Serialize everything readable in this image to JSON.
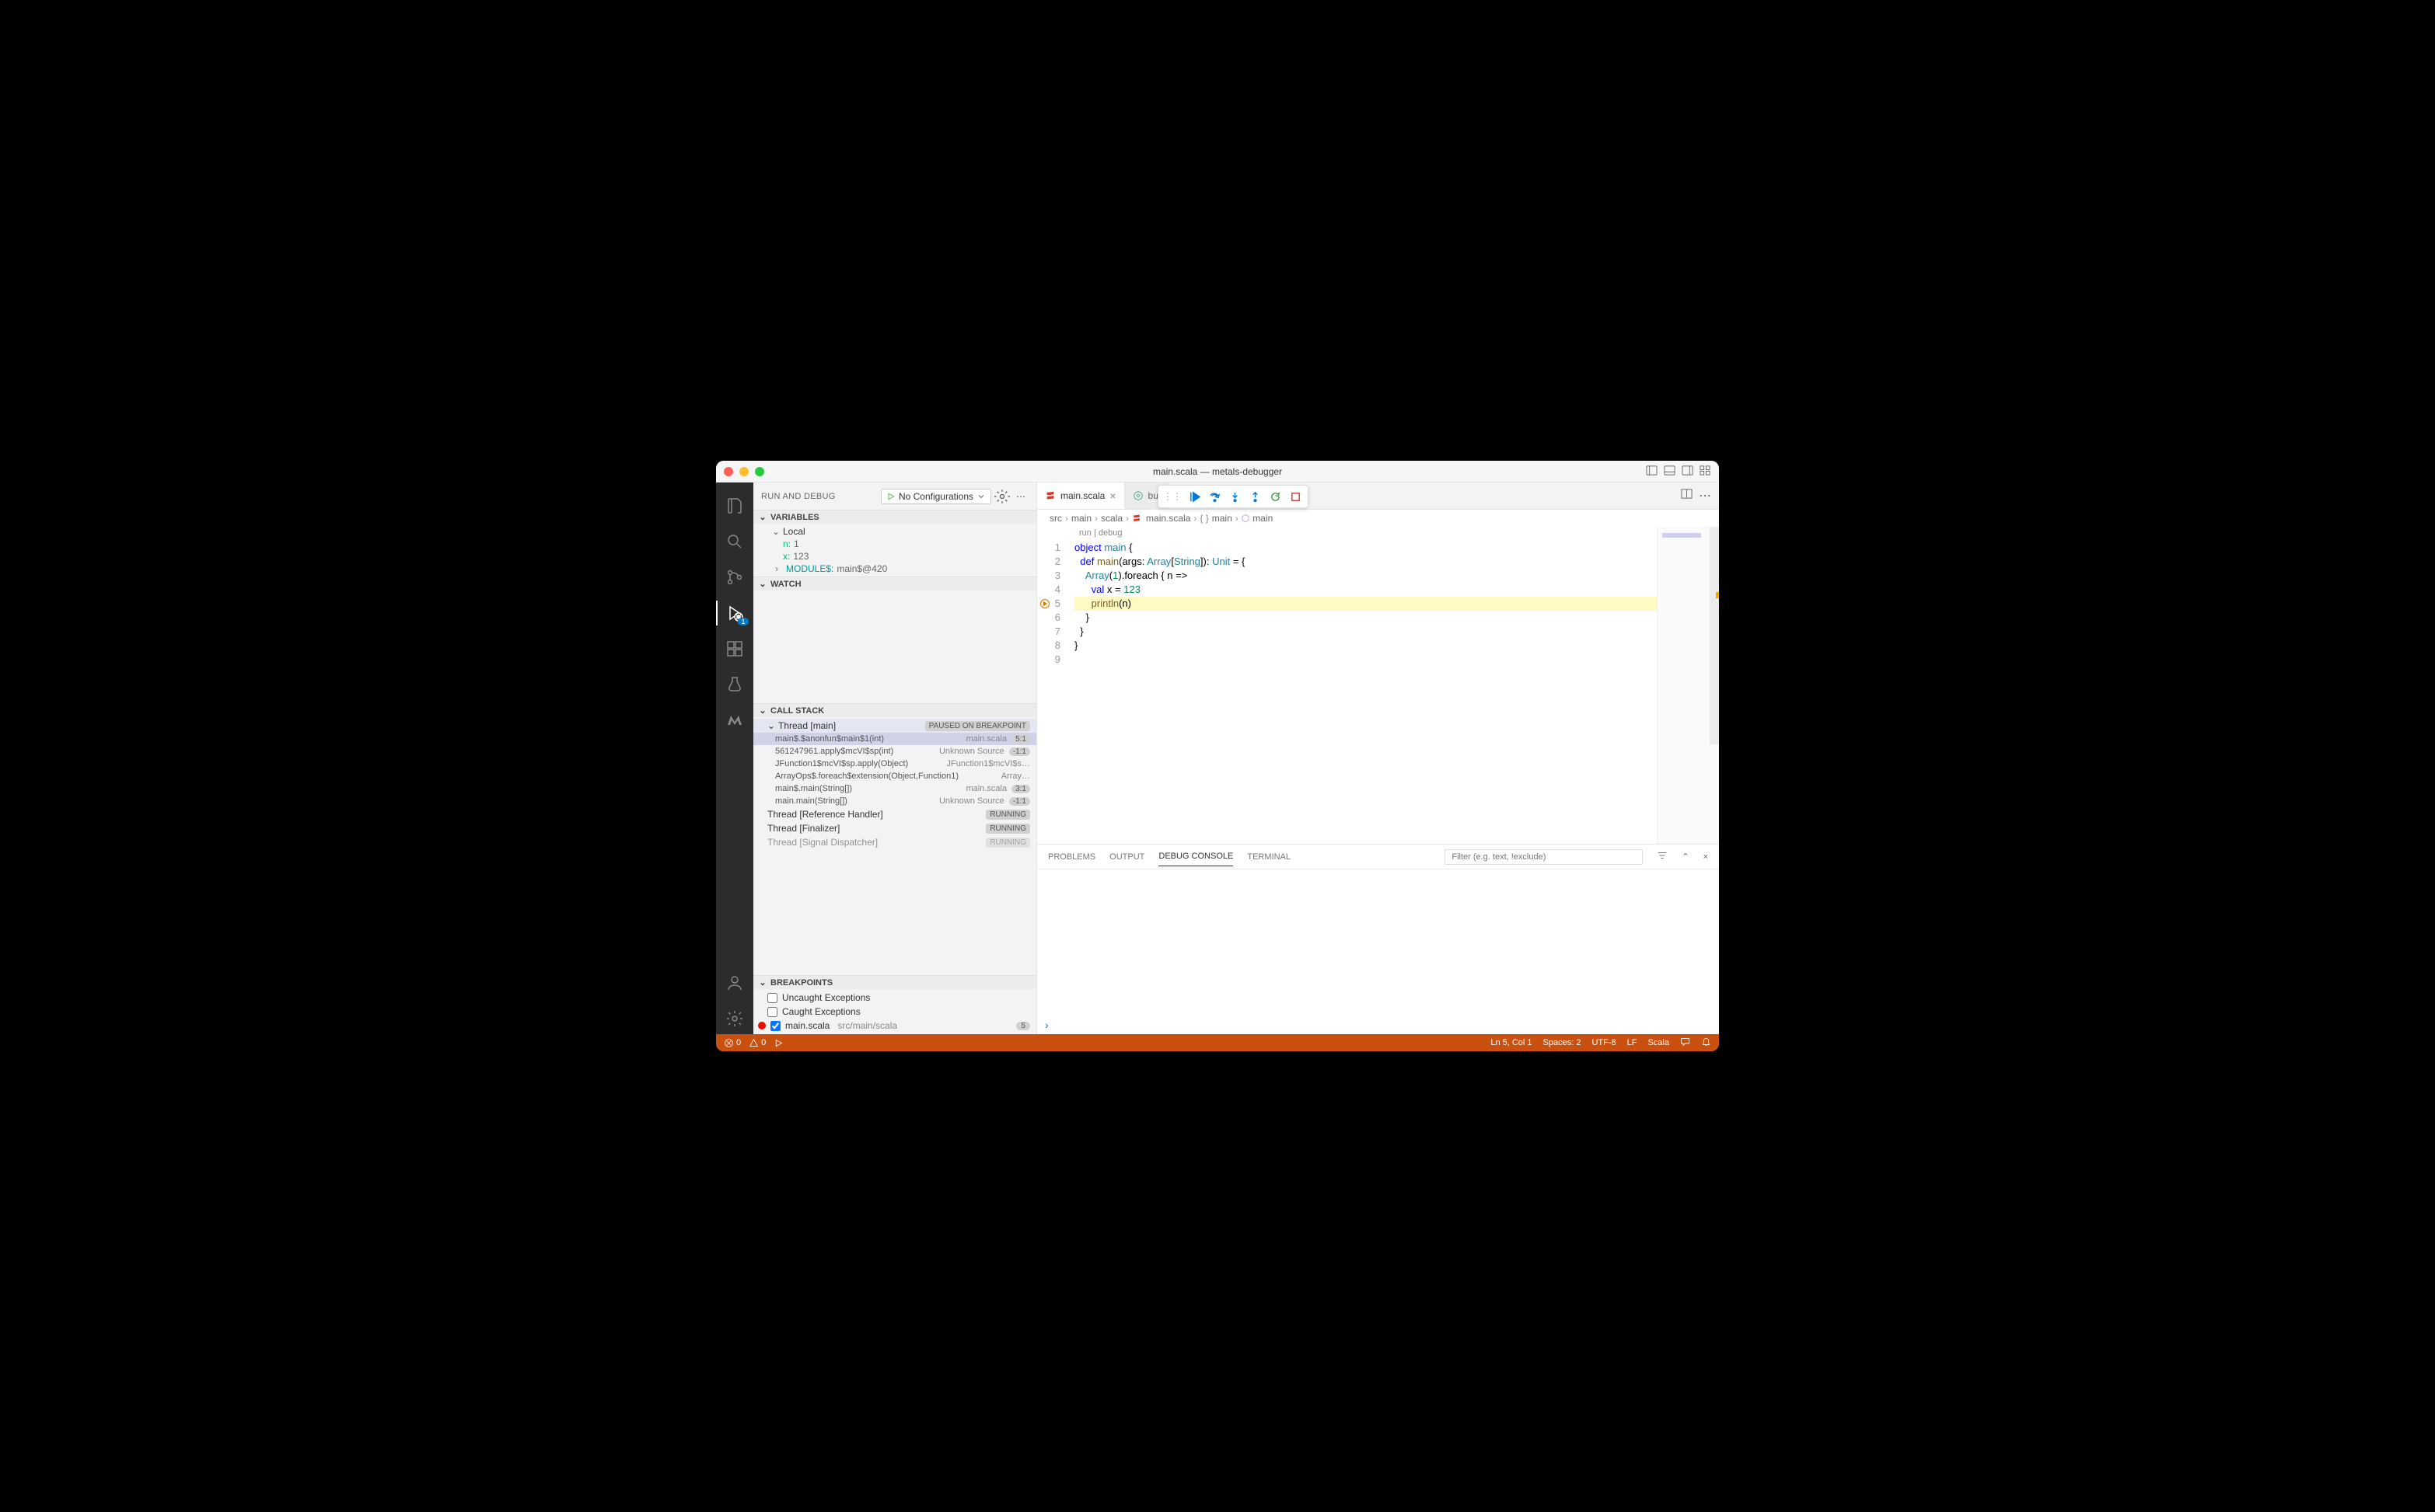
{
  "window": {
    "title": "main.scala — metals-debugger"
  },
  "sidebar": {
    "title": "RUN AND DEBUG",
    "config_label": "No Configurations",
    "sections": {
      "variables": "VARIABLES",
      "watch": "WATCH",
      "callstack": "CALL STACK",
      "breakpoints": "BREAKPOINTS"
    },
    "vars": {
      "scope": "Local",
      "items": [
        {
          "k": "n:",
          "v": "1"
        },
        {
          "k": "x:",
          "v": "123"
        }
      ],
      "module_k": "MODULE$:",
      "module_v": "main$@420"
    },
    "callstack": {
      "thread": "Thread [main]",
      "thread_status": "PAUSED ON BREAKPOINT",
      "frames": [
        {
          "fn": "main$.$anonfun$main$1(int)",
          "src": "main.scala",
          "loc": "5:1"
        },
        {
          "fn": "561247961.apply$mcVI$sp(int)",
          "src": "Unknown Source",
          "loc": "-1:1"
        },
        {
          "fn": "JFunction1$mcVI$sp.apply(Object)",
          "src": "JFunction1$mcVI$s…",
          "loc": ""
        },
        {
          "fn": "ArrayOps$.foreach$extension(Object,Function1)",
          "src": "Array…",
          "loc": ""
        },
        {
          "fn": "main$.main(String[])",
          "src": "main.scala",
          "loc": "3:1"
        },
        {
          "fn": "main.main(String[])",
          "src": "Unknown Source",
          "loc": "-1:1"
        }
      ],
      "others": [
        {
          "name": "Thread [Reference Handler]",
          "status": "RUNNING"
        },
        {
          "name": "Thread [Finalizer]",
          "status": "RUNNING"
        },
        {
          "name": "Thread [Signal Dispatcher]",
          "status": "RUNNING"
        }
      ]
    },
    "breakpoints": {
      "uncaught": "Uncaught Exceptions",
      "caught": "Caught Exceptions",
      "file": {
        "name": "main.scala",
        "path": "src/main/scala",
        "line": "5"
      }
    }
  },
  "tabs": [
    {
      "label": "main.scala",
      "icon": "scala"
    },
    {
      "label": "bui",
      "icon": "target"
    }
  ],
  "crumbs": [
    "src",
    "main",
    "scala",
    "main.scala",
    "{} main",
    "main"
  ],
  "codelens": {
    "run": "run",
    "debug": "debug"
  },
  "code": {
    "lines": [
      "1",
      "2",
      "3",
      "4",
      "5",
      "6",
      "7",
      "8",
      "9"
    ],
    "l1a": "object ",
    "l1b": "main",
    " l1c": " {",
    "l2": "  def main(args: Array[String]): Unit = {",
    "l3": "    Array(1).foreach { n =>",
    "l4": "      val x = 123",
    "l5": "      println(n)",
    "l6": "    }",
    "l7": "  }",
    "l8": "}"
  },
  "panel": {
    "tabs": {
      "problems": "PROBLEMS",
      "output": "OUTPUT",
      "debug": "DEBUG CONSOLE",
      "terminal": "TERMINAL"
    },
    "filter_placeholder": "Filter (e.g. text, !exclude)"
  },
  "status": {
    "errors": "0",
    "warnings": "0",
    "ln": "Ln 5, Col 1",
    "spaces": "Spaces: 2",
    "encoding": "UTF-8",
    "eol": "LF",
    "lang": "Scala"
  },
  "activity_badge": "1"
}
